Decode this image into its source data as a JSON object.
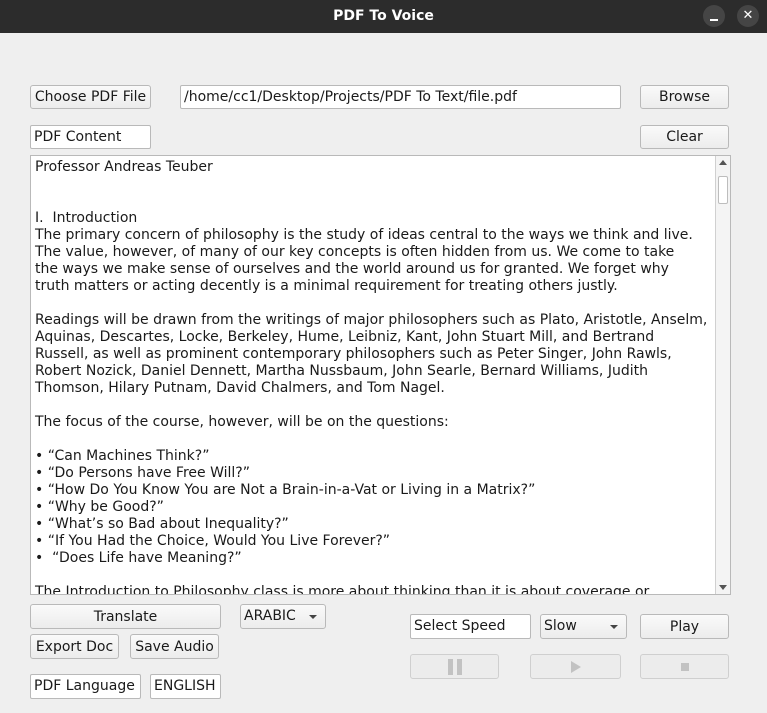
{
  "window": {
    "title": "PDF To Voice"
  },
  "file": {
    "choose_label": "Choose PDF File",
    "path": "/home/cc1/Desktop/Projects/PDF To Text/file.pdf",
    "browse_label": "Browse"
  },
  "content": {
    "label": "PDF Content",
    "clear_label": "Clear",
    "text": "Professor Andreas Teuber\n\n\nI.  Introduction\nThe primary concern of philosophy is the study of ideas central to the ways we think and live.\nThe value, however, of many of our key concepts is often hidden from us. We come to take\nthe ways we make sense of ourselves and the world around us for granted. We forget why\ntruth matters or acting decently is a minimal requirement for treating others justly.\n\nReadings will be drawn from the writings of major philosophers such as Plato, Aristotle, Anselm,\nAquinas, Descartes, Locke, Berkeley, Hume, Leibniz, Kant, John Stuart Mill, and Bertrand\nRussell, as well as prominent contemporary philosophers such as Peter Singer, John Rawls,\nRobert Nozick, Daniel Dennett, Martha Nussbaum, John Searle, Bernard Williams, Judith\nThomson, Hilary Putnam, David Chalmers, and Tom Nagel.\n\nThe focus of the course, however, will be on the questions:\n\n• “Can Machines Think?”\n• “Do Persons have Free Will?”\n• “How Do You Know You are Not a Brain-in-a-Vat or Living in a Matrix?”\n• “Why be Good?”\n• “What’s so Bad about Inequality?”\n• “If You Had the Choice, Would You Live Forever?”\n•  “Does Life have Meaning?”\n\nThe Introduction to Philosophy class is more about thinking than it is about coverage or"
  },
  "controls": {
    "translate_label": "Translate",
    "language_selected": "ARABIC",
    "export_label": "Export Doc",
    "save_audio_label": "Save Audio",
    "pdf_language_label": "PDF Language",
    "pdf_language_value": "ENGLISH",
    "select_speed_label": "Select Speed",
    "speed_selected": "Slow",
    "play_label": "Play"
  },
  "icons": {
    "pause": "pause-icon",
    "play": "play-icon",
    "stop": "stop-icon"
  }
}
